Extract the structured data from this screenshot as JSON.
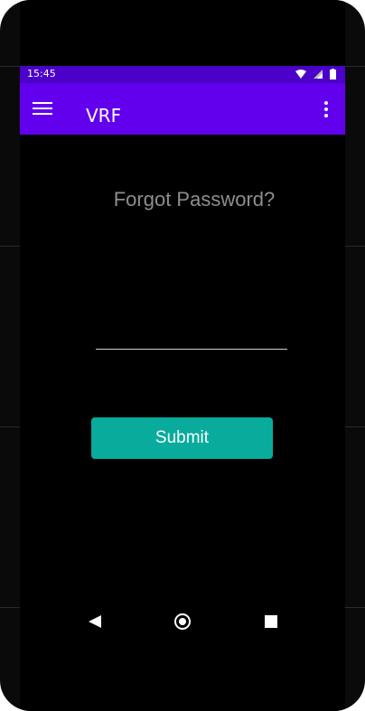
{
  "status_bar": {
    "time": "15:45",
    "icons": [
      "wifi-icon",
      "signal-icon",
      "battery-icon"
    ]
  },
  "app_bar": {
    "title": "VRF",
    "menu_icon": "hamburger-menu-icon",
    "overflow_icon": "more-vertical-icon"
  },
  "form": {
    "heading": "Forgot Password?",
    "email_value": "",
    "email_placeholder": "",
    "submit_label": "Submit"
  },
  "nav_bar": {
    "icons": [
      "back-icon",
      "home-icon",
      "recents-icon"
    ]
  },
  "colors": {
    "status_bar": "#4b01c8",
    "app_bar": "#6200ee",
    "submit_button": "#08ab9c",
    "heading_text": "#8e8e8e",
    "background": "#000000"
  }
}
